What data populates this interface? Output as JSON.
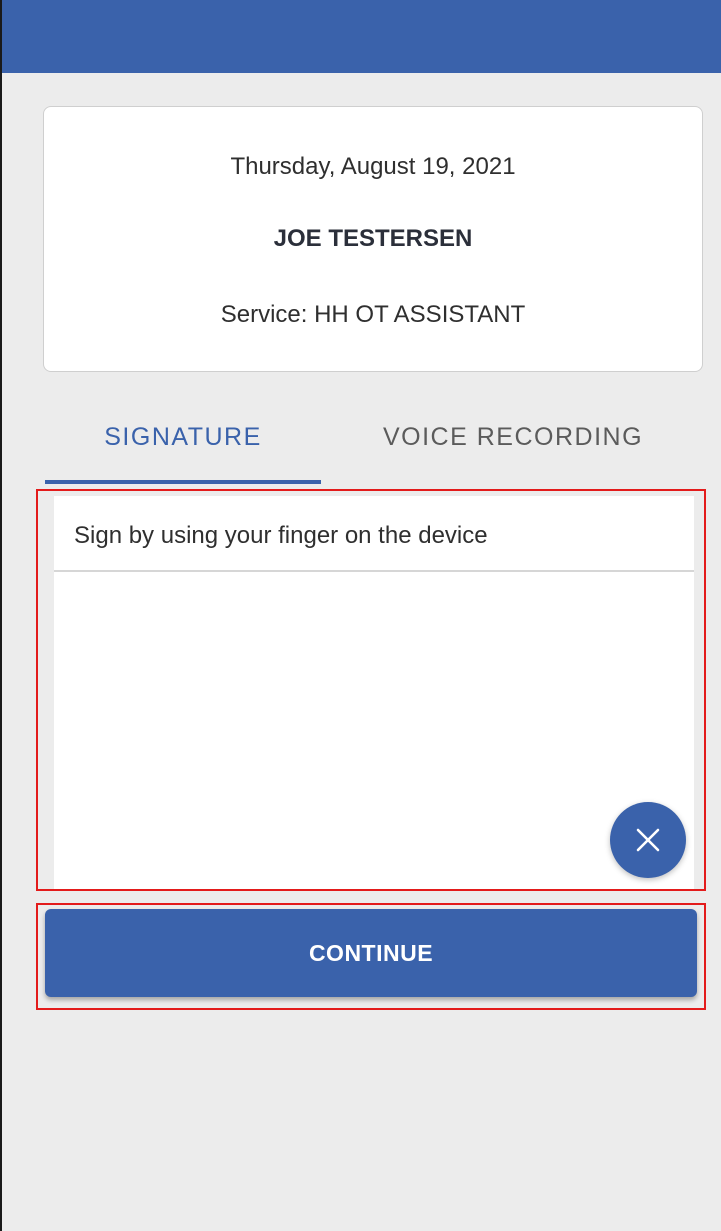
{
  "visit": {
    "date": "Thursday, August 19, 2021",
    "client_name": "JOE TESTERSEN",
    "service": "Service: HH OT ASSISTANT"
  },
  "tabs": [
    {
      "label": "SIGNATURE",
      "selected": true
    },
    {
      "label": "VOICE RECORDING",
      "selected": false
    }
  ],
  "signature": {
    "hint": "Sign by using your finger on the device",
    "clear_icon": "close-icon"
  },
  "actions": {
    "continue_label": "CONTINUE"
  },
  "colors": {
    "primary": "#3a62ab",
    "highlight": "#e31b1b",
    "background": "#ececec"
  }
}
